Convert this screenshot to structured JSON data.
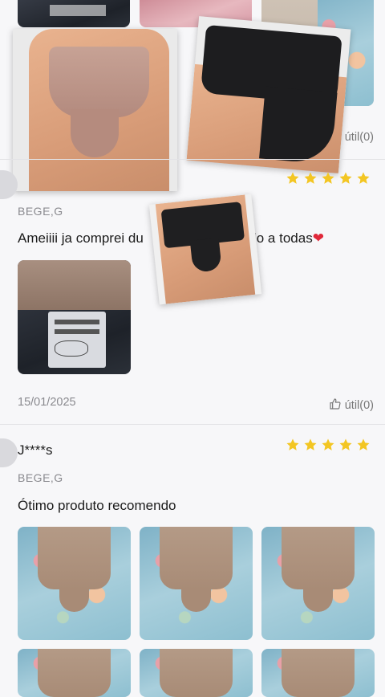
{
  "reviews": [
    {
      "helpful_label": "útil(0)"
    },
    {
      "variant": "BEGE,G",
      "text_before": "Ameiiii ja comprei du",
      "text_after": "ndo a todas",
      "heart": "❤",
      "date": "15/01/2025",
      "helpful_label": "útil(0)",
      "rating": 5
    },
    {
      "username": "J****s",
      "variant": "BEGE,G",
      "text": "Ótimo produto recomendo",
      "rating": 5
    }
  ],
  "colors": {
    "star": "#f3c623",
    "background": "#f7f7f9",
    "heart": "#e0283a"
  },
  "icons": {
    "star": "star-icon",
    "thumb_up": "thumb-up-icon"
  }
}
